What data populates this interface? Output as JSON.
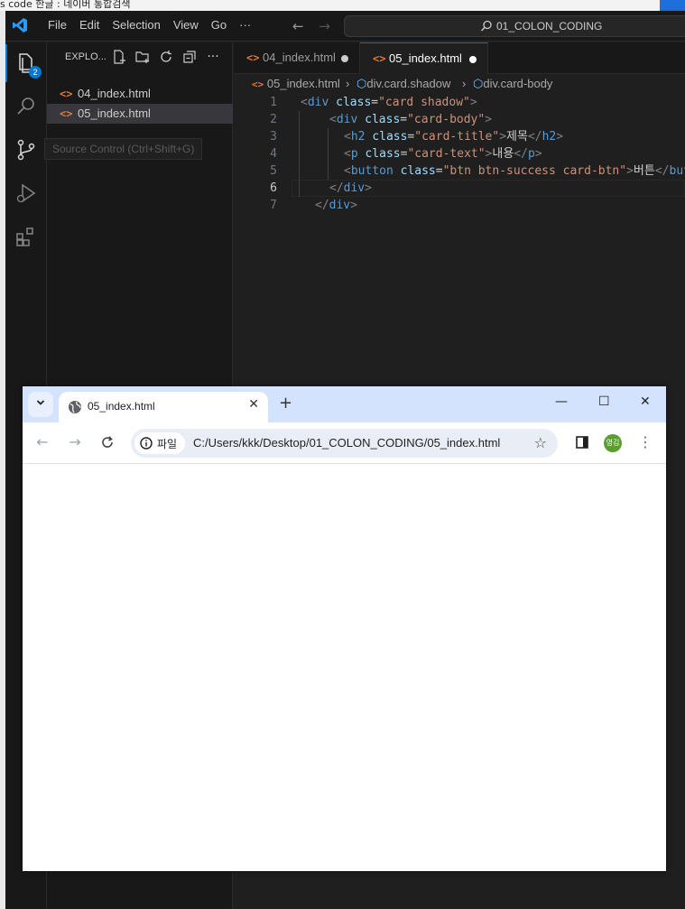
{
  "background_window": {
    "title": "s code 한글 : 네이버 통합검색"
  },
  "vscode": {
    "menu": [
      "File",
      "Edit",
      "Selection",
      "View",
      "Go",
      "···"
    ],
    "command_center": "01_COLON_CODING",
    "activity": {
      "explorer_badge": "2"
    },
    "explorer": {
      "title": "EXPLO...",
      "files": [
        {
          "name": "04_index.html",
          "selected": false
        },
        {
          "name": "05_index.html",
          "selected": true
        }
      ]
    },
    "tooltip": "Source Control (Ctrl+Shift+G)",
    "tabs": [
      {
        "label": "04_index.html",
        "active": false,
        "modified": true
      },
      {
        "label": "05_index.html",
        "active": true,
        "modified": true
      }
    ],
    "breadcrumb": {
      "file": "05_index.html",
      "seg1": "div.card.shadow",
      "seg2": "div.card-body"
    },
    "line_numbers": [
      "1",
      "2",
      "3",
      "4",
      "5",
      "6",
      "7"
    ],
    "current_line": "6",
    "code": {
      "l1": {
        "open": "<",
        "tag": "div",
        "attr": "class",
        "eq": "=",
        "val": "\"card shadow\"",
        "close": ">"
      },
      "l2": {
        "open": "<",
        "tag": "div",
        "attr": "class",
        "eq": "=",
        "val": "\"card-body\"",
        "close": ">"
      },
      "l3": {
        "open": "<",
        "tag": "h2",
        "attr": "class",
        "eq": "=",
        "val": "\"card-title\"",
        "close": ">",
        "text": "제목",
        "end_open": "</",
        "end_tag": "h2",
        "end_close": ">"
      },
      "l4": {
        "open": "<",
        "tag": "p",
        "attr": "class",
        "eq": "=",
        "val": "\"card-text\"",
        "close": ">",
        "text": "내용",
        "end_open": "</",
        "end_tag": "p",
        "end_close": ">"
      },
      "l5": {
        "open": "<",
        "tag": "button",
        "attr": "class",
        "eq": "=",
        "val": "\"btn btn-success card-btn\"",
        "close": ">",
        "text": "버튼",
        "end_open": "</",
        "end_tag": "butt"
      },
      "l6": {
        "open": "</",
        "tag": "div",
        "close": ">"
      },
      "l7": {
        "open": "</",
        "tag": "div",
        "close": ">"
      }
    }
  },
  "chrome": {
    "tab_title": "05_index.html",
    "site_chip_label": "파일",
    "url": "C:/Users/kkk/Desktop/01_COLON_CODING/05_index.html",
    "avatar_text": "영김"
  },
  "colors": {
    "vscode_bg": "#1f1f1f",
    "vscode_panel": "#181818",
    "accent": "#0078d4",
    "html_icon": "#e37933",
    "chrome_tabstrip": "#d3e3fd",
    "avatar": "#5a9e2f"
  }
}
